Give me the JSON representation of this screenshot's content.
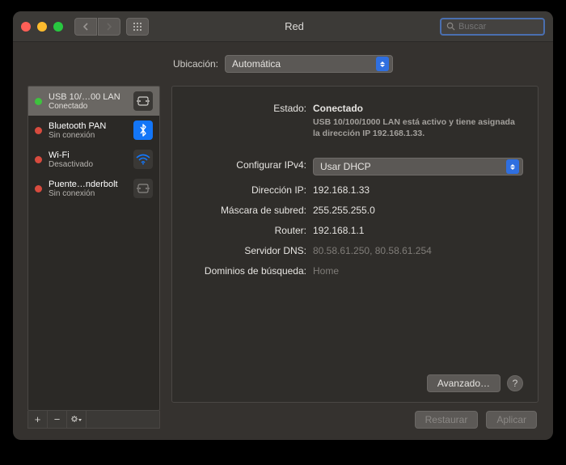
{
  "window": {
    "title": "Red"
  },
  "search": {
    "placeholder": "Buscar"
  },
  "location": {
    "label": "Ubicación:",
    "value": "Automática"
  },
  "sidebar": {
    "items": [
      {
        "name": "USB 10/…00 LAN",
        "status": "Conectado",
        "icon": "ethernet",
        "dot": "green",
        "selected": true
      },
      {
        "name": "Bluetooth PAN",
        "status": "Sin conexión",
        "icon": "bluetooth",
        "dot": "red",
        "selected": false
      },
      {
        "name": "Wi-Fi",
        "status": "Desactivado",
        "icon": "wifi",
        "dot": "red",
        "selected": false
      },
      {
        "name": "Puente…nderbolt",
        "status": "Sin conexión",
        "icon": "ethernet",
        "dot": "red",
        "selected": false
      }
    ]
  },
  "details": {
    "status_label": "Estado:",
    "status_value": "Conectado",
    "status_desc": "USB 10/100/1000 LAN está activo y tiene asignada la dirección IP 192.168.1.33.",
    "ipv4_label": "Configurar IPv4:",
    "ipv4_value": "Usar DHCP",
    "ip_label": "Dirección IP:",
    "ip_value": "192.168.1.33",
    "mask_label": "Máscara de subred:",
    "mask_value": "255.255.255.0",
    "router_label": "Router:",
    "router_value": "192.168.1.1",
    "dns_label": "Servidor DNS:",
    "dns_value": "80.58.61.250, 80.58.61.254",
    "search_label": "Dominios de búsqueda:",
    "search_value": "Home"
  },
  "buttons": {
    "advanced": "Avanzado…",
    "restore": "Restaurar",
    "apply": "Aplicar"
  }
}
